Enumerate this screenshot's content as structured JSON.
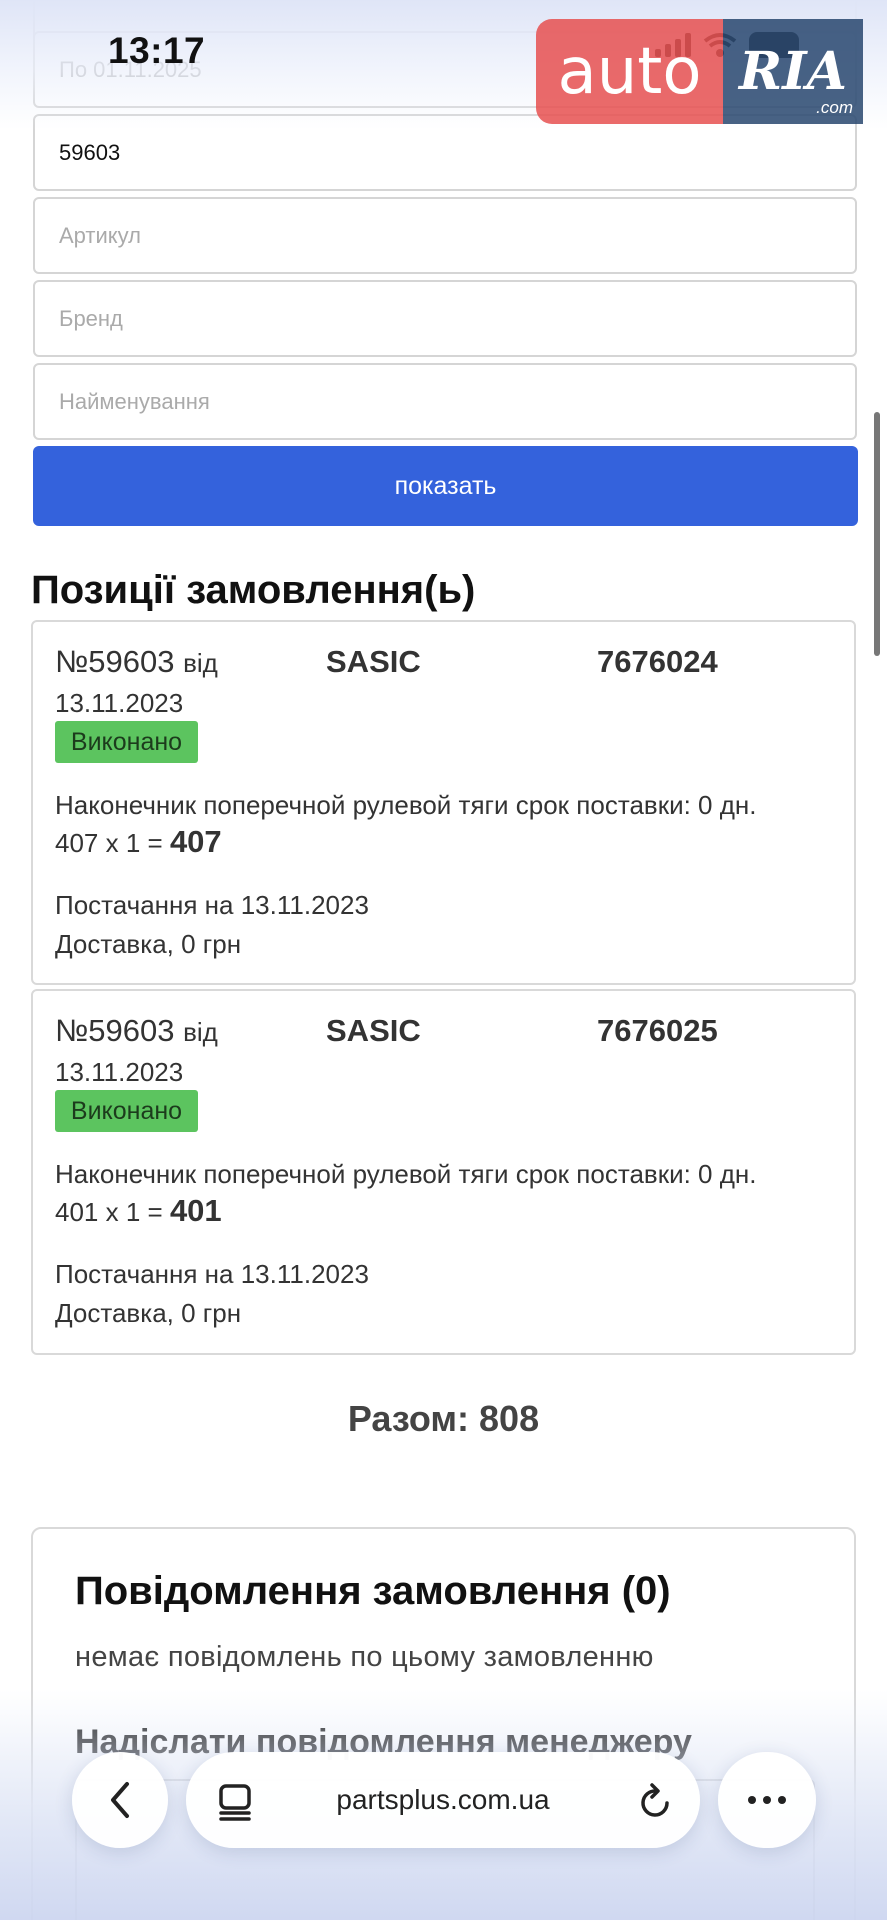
{
  "status_bar": {
    "time": "13:17"
  },
  "logo": {
    "auto": "auto",
    "ria": "RIA",
    "com": ".com"
  },
  "filters": {
    "date_to_placeholder": "По 01.11.2025",
    "order_number_value": "59603",
    "article_placeholder": "Артикул",
    "brand_placeholder": "Бренд",
    "name_placeholder": "Найменування",
    "show_button": "показать"
  },
  "positions_title": "Позиції замовлення(ь)",
  "positions": [
    {
      "number": "№59603",
      "from": "від",
      "date": "13.11.2023",
      "brand": "SASIC",
      "article": "7676024",
      "status": "Виконано",
      "description": "Наконечник поперечной рулевой тяги срок поставки: 0 дн.",
      "calc": "407 x 1 =",
      "sum": "407",
      "supply": "Постачання на 13.11.2023",
      "delivery": "Доставка, 0 грн"
    },
    {
      "number": "№59603",
      "from": "від",
      "date": "13.11.2023",
      "brand": "SASIC",
      "article": "7676025",
      "status": "Виконано",
      "description": "Наконечник поперечной рулевой тяги срок поставки: 0 дн.",
      "calc": "401 x 1 =",
      "sum": "401",
      "supply": "Постачання на 13.11.2023",
      "delivery": "Доставка, 0 грн"
    }
  ],
  "total": "Разом: 808",
  "messages": {
    "title": "Повідомлення замовлення (0)",
    "empty": "немає повідомлень по цьому замовленню",
    "send_title": "Надіслати повідомлення менеджеру"
  },
  "browser": {
    "url": "partsplus.com.ua"
  },
  "colors": {
    "accent": "#3462dc",
    "status_done": "#5cc45f"
  },
  "icons": [
    "back-arrow-icon",
    "tabs-icon",
    "reload-icon",
    "more-icon",
    "wifi-icon",
    "signal-icon",
    "battery-icon"
  ]
}
